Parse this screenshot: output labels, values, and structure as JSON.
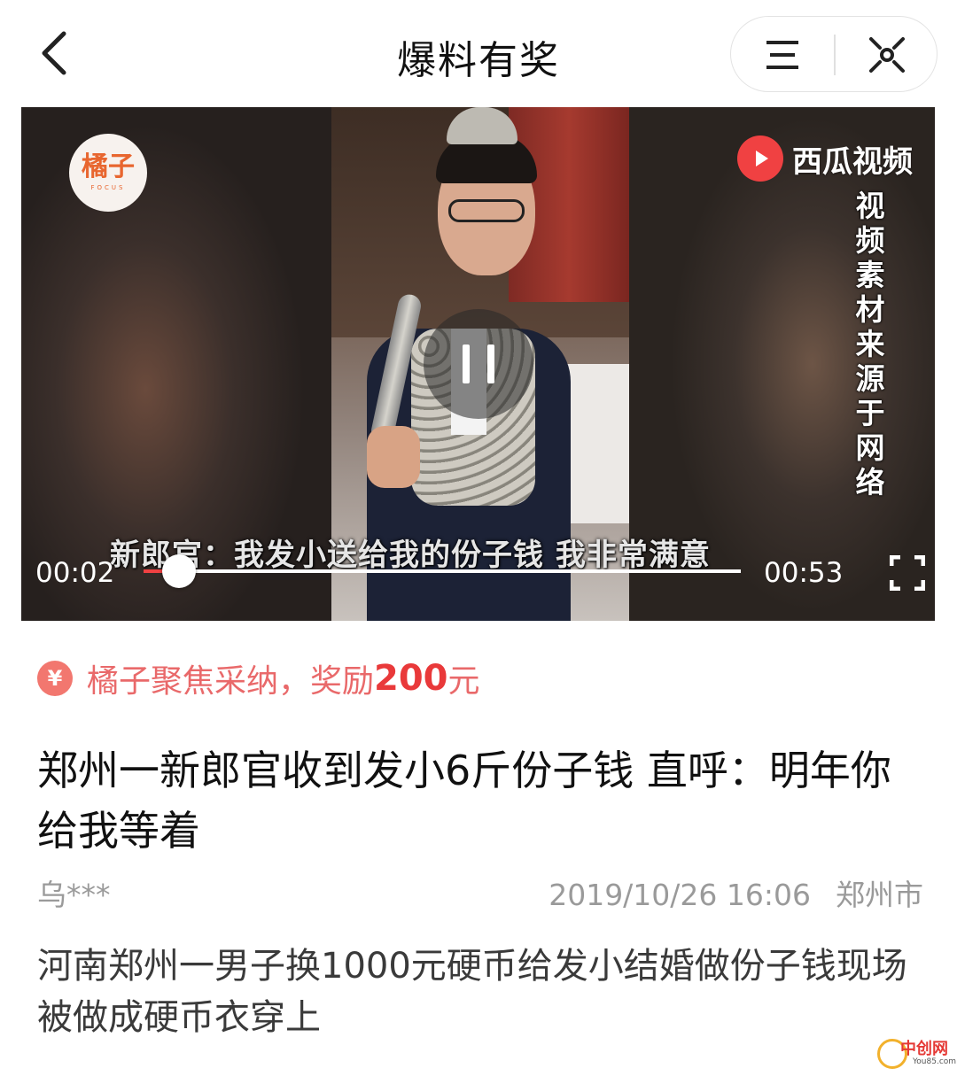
{
  "navbar": {
    "title": "爆料有奖",
    "back_icon": "chevron-left-icon",
    "menu_icon": "hamburger-menu-icon",
    "close_icon": "close-dots-icon"
  },
  "video": {
    "logo_text": "橘子",
    "logo_sub": "FOCUS",
    "platform_name": "西瓜视频",
    "platform_icon": "play-triangle-icon",
    "source_note": "视频素材来源于网络",
    "subtitle": "新郎官：我发小送给我的份子钱 我非常满意",
    "current_time": "00:02",
    "total_time": "00:53",
    "progress_fraction": 0.06,
    "state": "playing",
    "accent_color": "#f04142"
  },
  "reward": {
    "icon_symbol": "¥",
    "text": "橘子聚焦采纳，奖励",
    "amount": "200",
    "unit": "元",
    "color": "#e9696a"
  },
  "article": {
    "headline": "郑州一新郎官收到发小6斤份子钱 直呼：明年你给我等着",
    "author": "乌***",
    "datetime": "2019/10/26 16:06",
    "location": "郑州市",
    "summary": "河南郑州一男子换1000元硬币给发小结婚做份子钱现场被做成硬币衣穿上"
  },
  "watermark": {
    "text": "中创网",
    "sub": "You85.com"
  }
}
